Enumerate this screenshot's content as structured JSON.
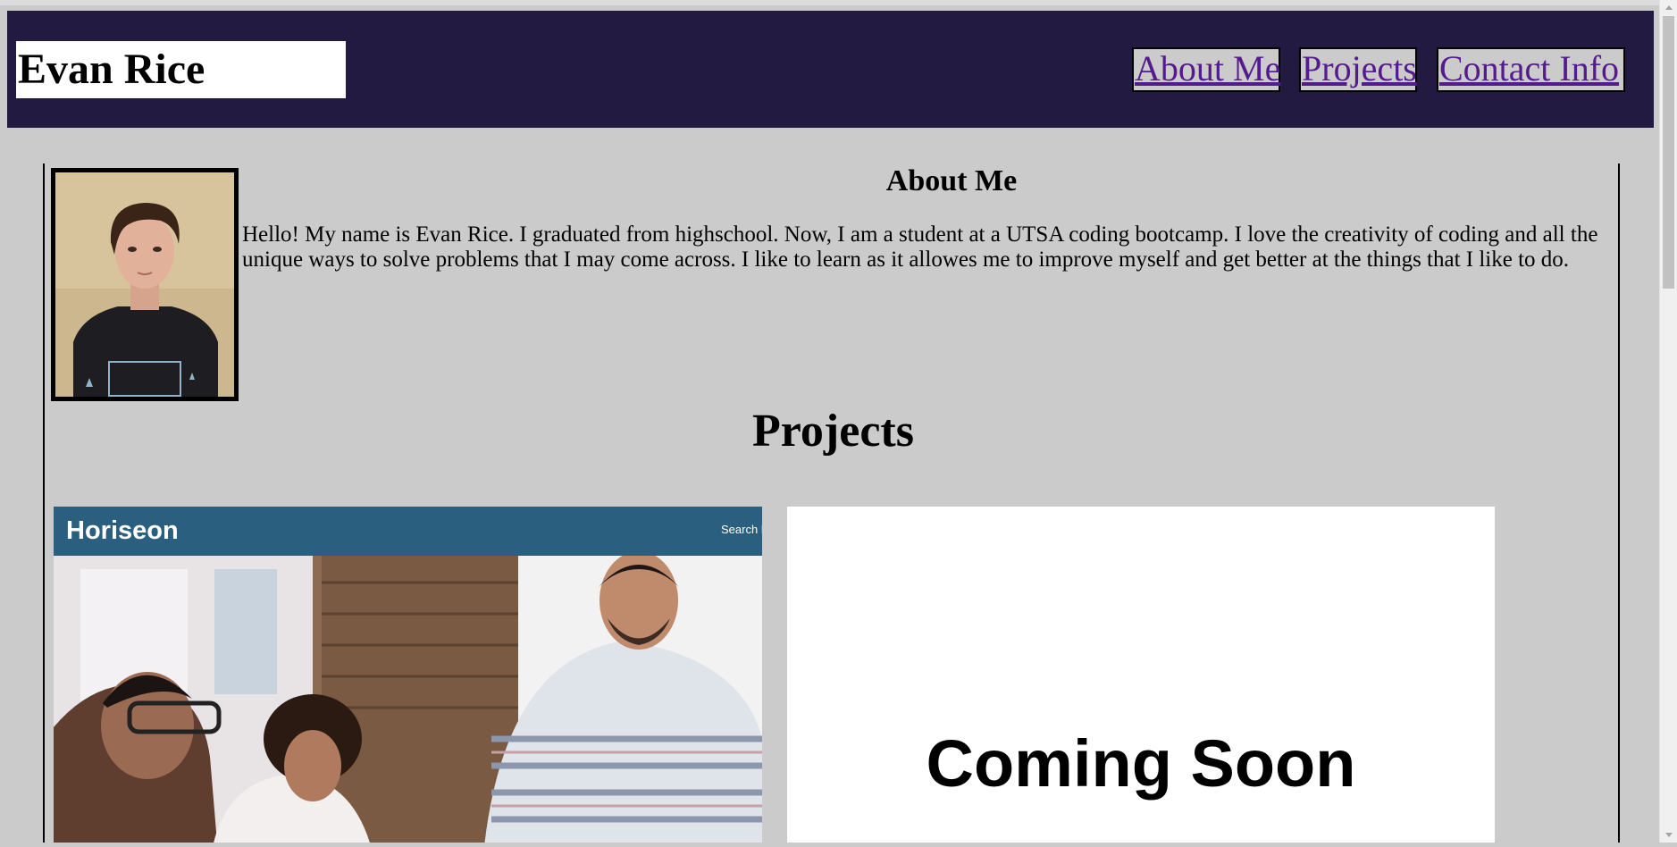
{
  "header": {
    "site_title": "Evan Rice",
    "nav": {
      "about": "About Me",
      "projects": "Projects",
      "contact": "Contact Info"
    }
  },
  "about": {
    "heading": "About Me",
    "text": "Hello! My name is Evan Rice. I graduated from highschool. Now, I am a student at a UTSA coding bootcamp. I love the creativity of coding and all the unique ways to solve problems that I may come across. I like to learn as it allowes me to improve myself and get better at the things that I like to do."
  },
  "projects": {
    "heading": "Projects",
    "items": [
      {
        "logo": "Horiseon",
        "search": "Search E"
      },
      {
        "caption": "Coming Soon"
      }
    ]
  },
  "colors": {
    "header_bg": "#221a40",
    "page_bg": "#cbcbcb",
    "link": "#551a8b",
    "horiseon_bar": "#2b5f7f"
  },
  "icons": [
    "scroll-up-arrow-icon",
    "scroll-down-arrow-icon"
  ]
}
